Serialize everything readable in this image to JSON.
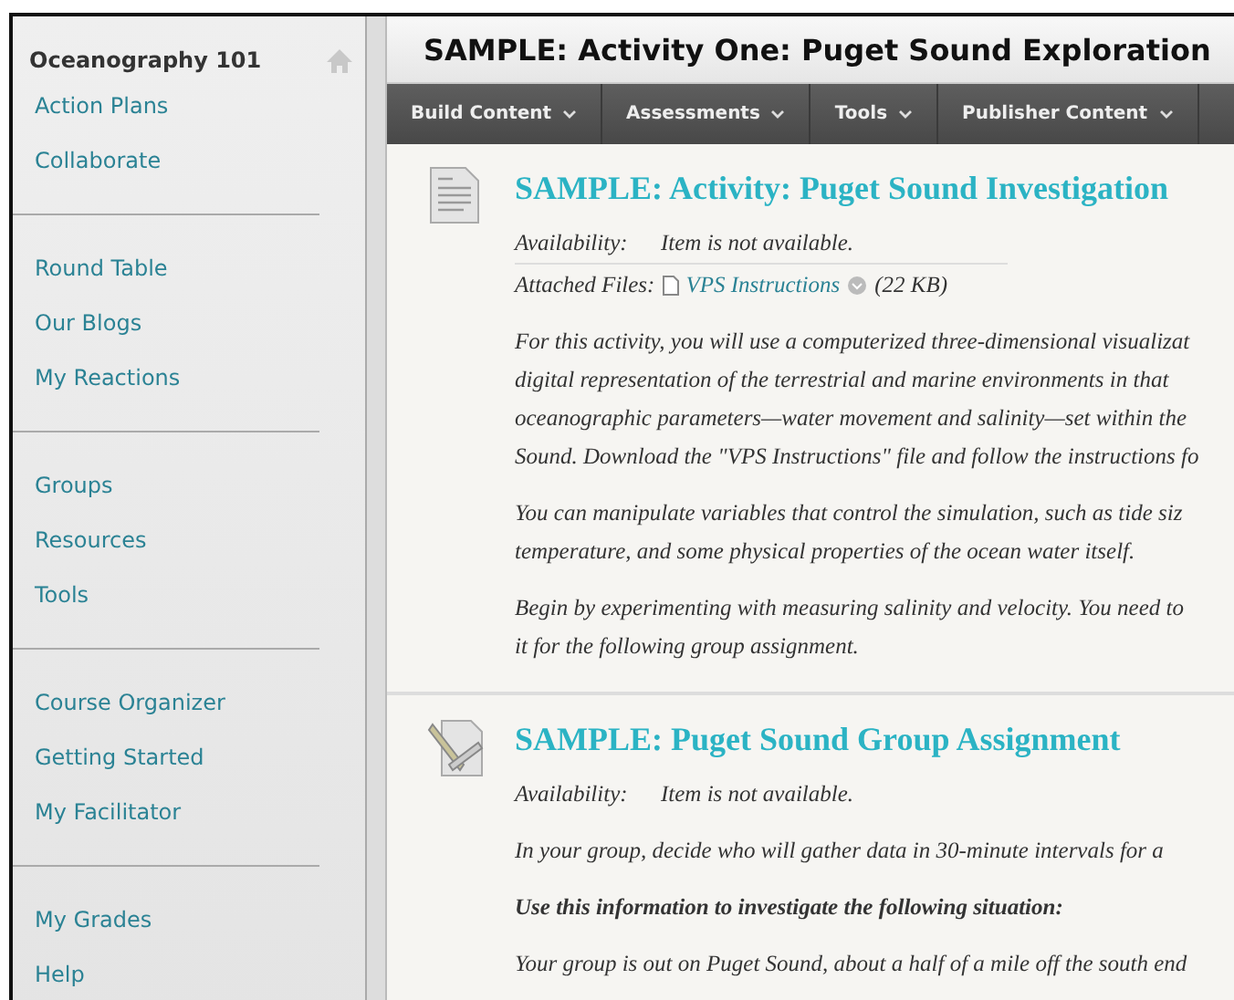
{
  "sidebar": {
    "title": "Oceanography 101",
    "groups": [
      [
        "Action Plans",
        "Collaborate"
      ],
      [
        "Round Table",
        "Our Blogs",
        "My Reactions"
      ],
      [
        "Groups",
        "Resources",
        "Tools"
      ],
      [
        "Course Organizer",
        "Getting Started",
        "My Facilitator"
      ],
      [
        "My Grades",
        "Help"
      ]
    ]
  },
  "page_title": "SAMPLE: Activity One: Puget Sound Exploration",
  "menu": [
    "Build Content",
    "Assessments",
    "Tools",
    "Publisher Content"
  ],
  "items": [
    {
      "kind": "document",
      "title": "SAMPLE: Activity: Puget Sound Investigation",
      "availability_label": "Availability:",
      "availability": "Item is not available.",
      "files_label": "Attached Files:",
      "file_link": "VPS Instructions",
      "file_size": "(22 KB)",
      "paragraphs": [
        {
          "bold": false,
          "lines": [
            "For this activity, you will use a computerized three-dimensional visualizat",
            "digital representation of the terrestrial and marine environments in that",
            "oceanographic parameters—water movement and salinity—set within the",
            "Sound. Download the \"VPS Instructions\" file and follow the instructions fo"
          ]
        },
        {
          "bold": false,
          "lines": [
            "You can manipulate variables that control the simulation, such as tide siz",
            "temperature, and some physical properties of the ocean water itself."
          ]
        },
        {
          "bold": false,
          "lines": [
            "Begin by experimenting with measuring salinity and velocity. You need to",
            "it for the following group assignment."
          ]
        }
      ]
    },
    {
      "kind": "assignment",
      "title": "SAMPLE: Puget Sound Group Assignment",
      "availability_label": "Availability:",
      "availability": "Item is not available.",
      "paragraphs": [
        {
          "bold": false,
          "lines": [
            "In your group, decide who will gather data in 30-minute intervals for a"
          ]
        },
        {
          "bold": true,
          "lines": [
            "Use this information to investigate the following situation:"
          ]
        },
        {
          "bold": false,
          "lines": [
            "Your group is out on Puget Sound, about a half of a mile off the south end"
          ]
        }
      ]
    }
  ]
}
